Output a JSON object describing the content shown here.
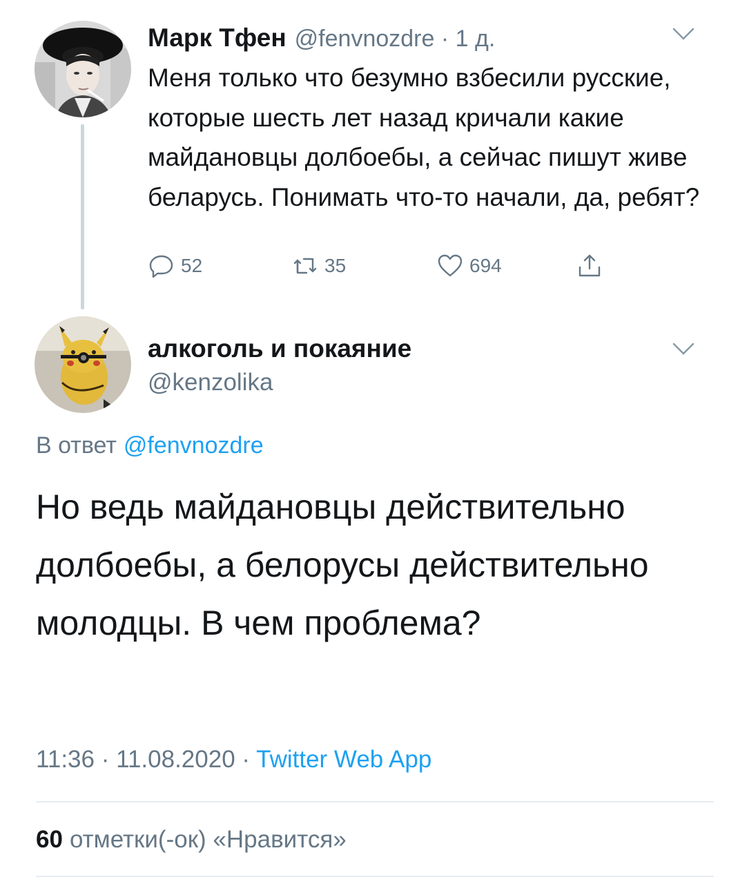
{
  "parent_tweet": {
    "display_name": "Марк Тфен",
    "meta": "@fenvnozdre · 1 д.",
    "text": "Меня только что безумно взбесили русские, которые шесть лет назад кричали какие майдановцы долбоебы, а сейчас пишут живе беларусь. Понимать что-то начали, да, ребят?",
    "actions": {
      "replies": "52",
      "retweets": "35",
      "likes": "694"
    },
    "icons": [
      "reply-icon",
      "retweet-icon",
      "like-icon",
      "share-icon",
      "chevron-down-icon"
    ]
  },
  "reply_tweet": {
    "display_name": "алкоголь и покаяние",
    "handle": "@kenzolika",
    "reply_label": "В ответ",
    "reply_mention": "@fenvnozdre",
    "text": "Но ведь майдановцы действительно долбоебы, а белорусы действительно молодцы. В чем проблема?",
    "timestamp": "11:36 · 11.08.2020 · ",
    "source": "Twitter Web App",
    "likes_count": "60",
    "likes_label": "отметки(-ок) «Нравится»"
  },
  "colors": {
    "text_primary": "#14171a",
    "text_secondary": "#657786",
    "link_blue": "#1da1f2",
    "divider": "#e6ecf0",
    "thread_line": "#ccd6dd"
  }
}
